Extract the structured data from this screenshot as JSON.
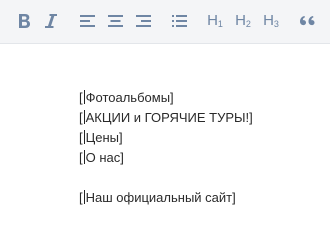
{
  "toolbar": {
    "buttons": [
      {
        "name": "bold-icon"
      },
      {
        "name": "italic-icon"
      },
      {
        "name": "align-left-icon"
      },
      {
        "name": "align-center-icon"
      },
      {
        "name": "align-right-icon"
      },
      {
        "name": "bulleted-list-icon"
      },
      {
        "name": "heading-1-icon",
        "label": "H",
        "sub": "1"
      },
      {
        "name": "heading-2-icon",
        "label": "H",
        "sub": "2"
      },
      {
        "name": "heading-3-icon",
        "label": "H",
        "sub": "3"
      },
      {
        "name": "quote-icon"
      }
    ],
    "icon_color": "#6f86a4",
    "background": "#f4f5f7"
  },
  "content": {
    "lines": [
      {
        "open": "[",
        "text": "Фотоальбомы]"
      },
      {
        "open": "[",
        "text": "АКЦИИ и ГОРЯЧИЕ ТУРЫ!]"
      },
      {
        "open": "[",
        "text": "Цены]"
      },
      {
        "open": "[",
        "text": "О нас]"
      },
      {
        "open": "[",
        "text": "Наш официальный сайт]"
      }
    ]
  }
}
